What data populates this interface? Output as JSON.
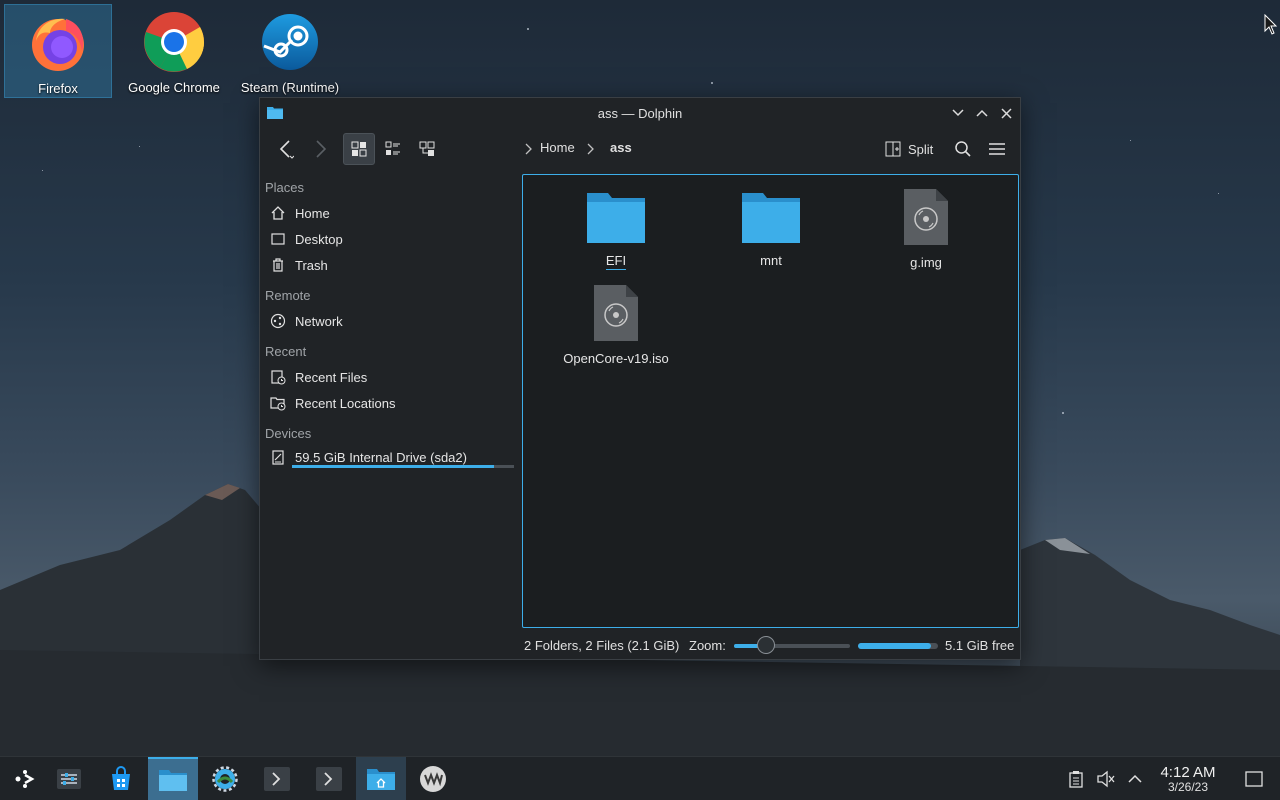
{
  "desktop": {
    "icons": [
      {
        "label": "Firefox",
        "icon": "firefox-icon"
      },
      {
        "label": "Google Chrome",
        "icon": "chrome-icon"
      },
      {
        "label": "Steam (Runtime)",
        "icon": "steam-icon"
      }
    ]
  },
  "window": {
    "title": "ass — Dolphin",
    "toolbar": {
      "breadcrumb": [
        "Home",
        "ass"
      ],
      "split_label": "Split"
    },
    "sidebar": {
      "sections": [
        {
          "heading": "Places",
          "items": [
            "Home",
            "Desktop",
            "Trash"
          ]
        },
        {
          "heading": "Remote",
          "items": [
            "Network"
          ]
        },
        {
          "heading": "Recent",
          "items": [
            "Recent Files",
            "Recent Locations"
          ]
        },
        {
          "heading": "Devices",
          "items": [
            "59.5 GiB Internal Drive (sda2)"
          ]
        }
      ],
      "drive_usage_fraction": 0.91
    },
    "files": [
      {
        "name": "EFI",
        "type": "folder"
      },
      {
        "name": "mnt",
        "type": "folder"
      },
      {
        "name": "g.img",
        "type": "disk-image"
      },
      {
        "name": "OpenCore-v19.iso",
        "type": "disk-image"
      }
    ],
    "statusbar": {
      "summary": "2 Folders, 2 Files (2.1 GiB)",
      "zoom_label": "Zoom:",
      "zoom_fraction": 0.28,
      "free_space_used_fraction": 0.91,
      "free_text": "5.1 GiB free"
    }
  },
  "taskbar": {
    "time": "4:12 AM",
    "date": "3/26/23"
  },
  "colors": {
    "accent": "#3daee9",
    "window_bg": "#202326",
    "folder": "#3daee9"
  }
}
